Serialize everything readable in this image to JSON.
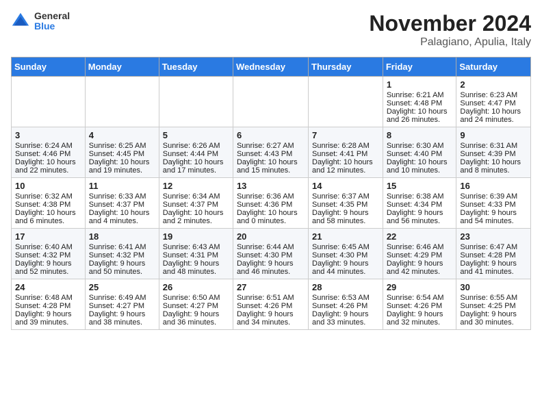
{
  "logo": {
    "general": "General",
    "blue": "Blue"
  },
  "title": "November 2024",
  "location": "Palagiano, Apulia, Italy",
  "days_of_week": [
    "Sunday",
    "Monday",
    "Tuesday",
    "Wednesday",
    "Thursday",
    "Friday",
    "Saturday"
  ],
  "weeks": [
    [
      {
        "day": "",
        "content": ""
      },
      {
        "day": "",
        "content": ""
      },
      {
        "day": "",
        "content": ""
      },
      {
        "day": "",
        "content": ""
      },
      {
        "day": "",
        "content": ""
      },
      {
        "day": "1",
        "content": "Sunrise: 6:21 AM\nSunset: 4:48 PM\nDaylight: 10 hours and 26 minutes."
      },
      {
        "day": "2",
        "content": "Sunrise: 6:23 AM\nSunset: 4:47 PM\nDaylight: 10 hours and 24 minutes."
      }
    ],
    [
      {
        "day": "3",
        "content": "Sunrise: 6:24 AM\nSunset: 4:46 PM\nDaylight: 10 hours and 22 minutes."
      },
      {
        "day": "4",
        "content": "Sunrise: 6:25 AM\nSunset: 4:45 PM\nDaylight: 10 hours and 19 minutes."
      },
      {
        "day": "5",
        "content": "Sunrise: 6:26 AM\nSunset: 4:44 PM\nDaylight: 10 hours and 17 minutes."
      },
      {
        "day": "6",
        "content": "Sunrise: 6:27 AM\nSunset: 4:43 PM\nDaylight: 10 hours and 15 minutes."
      },
      {
        "day": "7",
        "content": "Sunrise: 6:28 AM\nSunset: 4:41 PM\nDaylight: 10 hours and 12 minutes."
      },
      {
        "day": "8",
        "content": "Sunrise: 6:30 AM\nSunset: 4:40 PM\nDaylight: 10 hours and 10 minutes."
      },
      {
        "day": "9",
        "content": "Sunrise: 6:31 AM\nSunset: 4:39 PM\nDaylight: 10 hours and 8 minutes."
      }
    ],
    [
      {
        "day": "10",
        "content": "Sunrise: 6:32 AM\nSunset: 4:38 PM\nDaylight: 10 hours and 6 minutes."
      },
      {
        "day": "11",
        "content": "Sunrise: 6:33 AM\nSunset: 4:37 PM\nDaylight: 10 hours and 4 minutes."
      },
      {
        "day": "12",
        "content": "Sunrise: 6:34 AM\nSunset: 4:37 PM\nDaylight: 10 hours and 2 minutes."
      },
      {
        "day": "13",
        "content": "Sunrise: 6:36 AM\nSunset: 4:36 PM\nDaylight: 10 hours and 0 minutes."
      },
      {
        "day": "14",
        "content": "Sunrise: 6:37 AM\nSunset: 4:35 PM\nDaylight: 9 hours and 58 minutes."
      },
      {
        "day": "15",
        "content": "Sunrise: 6:38 AM\nSunset: 4:34 PM\nDaylight: 9 hours and 56 minutes."
      },
      {
        "day": "16",
        "content": "Sunrise: 6:39 AM\nSunset: 4:33 PM\nDaylight: 9 hours and 54 minutes."
      }
    ],
    [
      {
        "day": "17",
        "content": "Sunrise: 6:40 AM\nSunset: 4:32 PM\nDaylight: 9 hours and 52 minutes."
      },
      {
        "day": "18",
        "content": "Sunrise: 6:41 AM\nSunset: 4:32 PM\nDaylight: 9 hours and 50 minutes."
      },
      {
        "day": "19",
        "content": "Sunrise: 6:43 AM\nSunset: 4:31 PM\nDaylight: 9 hours and 48 minutes."
      },
      {
        "day": "20",
        "content": "Sunrise: 6:44 AM\nSunset: 4:30 PM\nDaylight: 9 hours and 46 minutes."
      },
      {
        "day": "21",
        "content": "Sunrise: 6:45 AM\nSunset: 4:30 PM\nDaylight: 9 hours and 44 minutes."
      },
      {
        "day": "22",
        "content": "Sunrise: 6:46 AM\nSunset: 4:29 PM\nDaylight: 9 hours and 42 minutes."
      },
      {
        "day": "23",
        "content": "Sunrise: 6:47 AM\nSunset: 4:28 PM\nDaylight: 9 hours and 41 minutes."
      }
    ],
    [
      {
        "day": "24",
        "content": "Sunrise: 6:48 AM\nSunset: 4:28 PM\nDaylight: 9 hours and 39 minutes."
      },
      {
        "day": "25",
        "content": "Sunrise: 6:49 AM\nSunset: 4:27 PM\nDaylight: 9 hours and 38 minutes."
      },
      {
        "day": "26",
        "content": "Sunrise: 6:50 AM\nSunset: 4:27 PM\nDaylight: 9 hours and 36 minutes."
      },
      {
        "day": "27",
        "content": "Sunrise: 6:51 AM\nSunset: 4:26 PM\nDaylight: 9 hours and 34 minutes."
      },
      {
        "day": "28",
        "content": "Sunrise: 6:53 AM\nSunset: 4:26 PM\nDaylight: 9 hours and 33 minutes."
      },
      {
        "day": "29",
        "content": "Sunrise: 6:54 AM\nSunset: 4:26 PM\nDaylight: 9 hours and 32 minutes."
      },
      {
        "day": "30",
        "content": "Sunrise: 6:55 AM\nSunset: 4:25 PM\nDaylight: 9 hours and 30 minutes."
      }
    ]
  ]
}
